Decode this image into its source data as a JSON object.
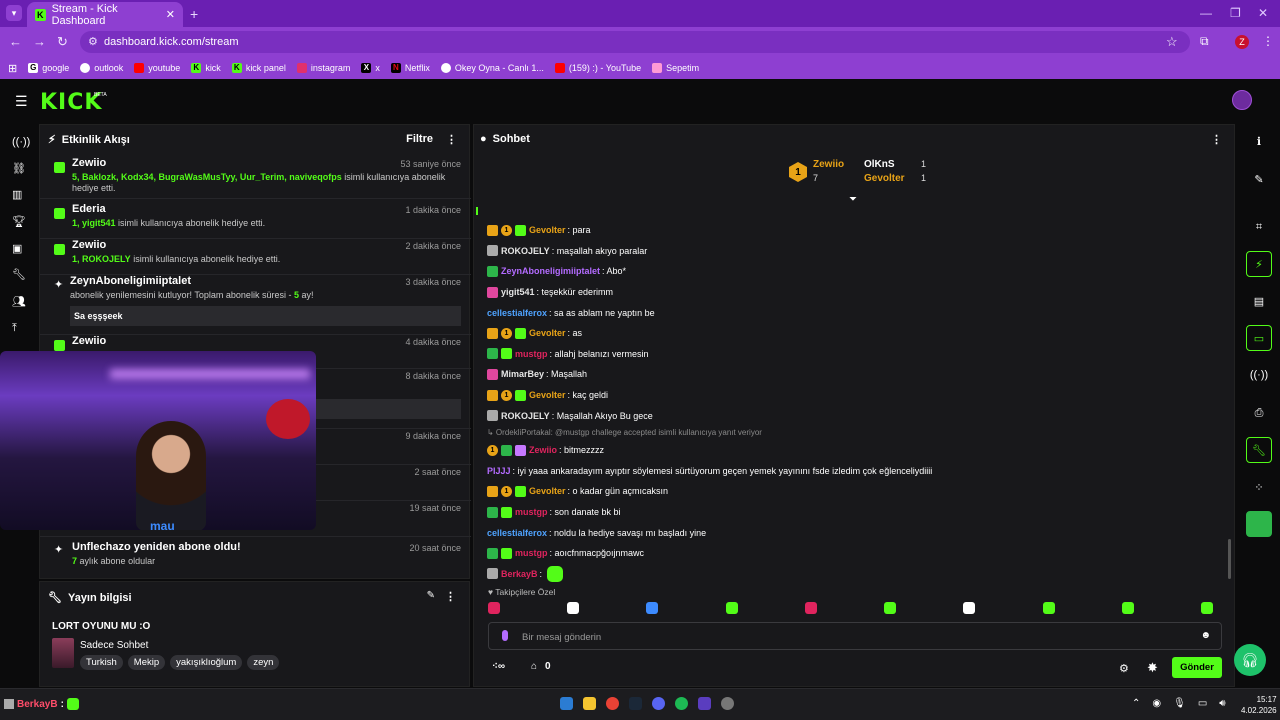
{
  "browser": {
    "tab_title": "Stream - Kick Dashboard",
    "url": "dashboard.kick.com/stream",
    "profile_initial": "Z",
    "bookmarks": [
      "google",
      "outlook",
      "youtube",
      "kick",
      "kick panel",
      "instagram",
      "x",
      "Netflix",
      "Okey Oyna - Canlı 1...",
      "(159) :) - YouTube",
      "Sepetim"
    ]
  },
  "app": {
    "logo": "KICK",
    "beta": "BETA"
  },
  "activity": {
    "title": "Etkinlik Akışı",
    "filter": "Filtre",
    "events": [
      {
        "who": "Zewiio",
        "time": "53 saniye önce",
        "names": "5, Baklozk, Kodx34, BugraWasMusTyy, Uur_Terim, naviveqofps",
        "text": "isimli kullanıcıya abonelik hediye etti."
      },
      {
        "who": "Ederia",
        "time": "1 dakika önce",
        "names": "1, yigit541",
        "text": "isimli kullanıcıya abonelik hediye etti."
      },
      {
        "who": "Zewiio",
        "time": "2 dakika önce",
        "names": "1, ROKOJELY",
        "text": "isimli kullanıcıya abonelik hediye etti."
      },
      {
        "who": "ZeynAboneligimiiptalet",
        "time": "3 dakika önce",
        "text": "abonelik yenilemesini kutluyor! Toplam abonelik süresi -",
        "months": "5",
        "text2": "ay!",
        "message": "Sa eşşşeek"
      },
      {
        "who": "Zewiio",
        "time": "4 dakika önce"
      },
      {
        "time": "8 dakika önce"
      },
      {
        "time": "9 dakika önce"
      },
      {
        "time": "2 saat önce"
      },
      {
        "time": "19 saat önce"
      },
      {
        "who": "Unflechazo yeniden abone oldu!",
        "time": "20 saat önce",
        "names": "7",
        "text": "aylık abone oldular"
      }
    ]
  },
  "webcam": {
    "text": "mau"
  },
  "stream_info": {
    "title": "Yayın bilgisi",
    "stream_title": "LORT OYUNU MU :O",
    "category": "Sadece Sohbet",
    "tags": [
      "Turkish",
      "Mekip",
      "yakışıklıoğlum",
      "zeyn"
    ]
  },
  "chat": {
    "title": "Sohbet",
    "top_gifter": {
      "rank": "1",
      "name": "Zewiio",
      "count": "7"
    },
    "gifters": [
      {
        "name": "OlKnS",
        "count": "1"
      },
      {
        "name": "Gevolter",
        "count": "1"
      }
    ],
    "messages": [
      {
        "badges": [
          "crown",
          "one",
          "gft"
        ],
        "user": "Gevolter",
        "color": "#e8a317",
        "text": ": para"
      },
      {
        "badges": [
          "cat"
        ],
        "user": "ROKOJELY",
        "color": "#e6e6e6",
        "text": ": maşallah akıyo paralar"
      },
      {
        "badges": [
          "fr"
        ],
        "user": "ZeynAboneligimiiptalet",
        "color": "#b36bff",
        "text": ": Abo*"
      },
      {
        "badges": [
          "hrt"
        ],
        "user": "yigit541",
        "color": "#e6e6e6",
        "text": ": teşekkür ederimm"
      },
      {
        "badges": [],
        "user": "cellestialferox",
        "color": "#4fa3ff",
        "text": ": sa as ablam ne yaptın be"
      },
      {
        "badges": [
          "crown",
          "one",
          "gft"
        ],
        "user": "Gevolter",
        "color": "#e8a317",
        "text": ": as"
      },
      {
        "badges": [
          "fr",
          "gft"
        ],
        "user": "mustgp",
        "color": "#e0245e",
        "text": ": allahj belanızı vermesin"
      },
      {
        "badges": [
          "hrt"
        ],
        "user": "MimarBey",
        "color": "#e6e6e6",
        "text": ": Maşallah"
      },
      {
        "badges": [
          "crown",
          "one",
          "gft"
        ],
        "user": "Gevolter",
        "color": "#e8a317",
        "text": ": kaç geldi"
      },
      {
        "badges": [
          "cat"
        ],
        "user": "ROKOJELY",
        "color": "#e6e6e6",
        "text": ": Maşallah Akıyo Bu gece"
      },
      {
        "reply": "↳ OrdekliPortakal: @mustgp challege accepted isimli kullanıcıya yanıt veriyor",
        "badges": [
          "one",
          "fr",
          "gfp"
        ],
        "user": "Zewiio",
        "color": "#e0245e",
        "text": ": bitmezzzz"
      },
      {
        "badges": [],
        "user": "PIJJJ",
        "color": "#b36bff",
        "text": ": iyi yaaa ankaradayım ayıptır söylemesi sürtüyorum geçen yemek yayınını fsde izledim çok eğlenceliydiiii"
      },
      {
        "badges": [
          "crown",
          "one",
          "gft"
        ],
        "user": "Gevolter",
        "color": "#e8a317",
        "text": ": o kadar gün açmıcaksın"
      },
      {
        "badges": [
          "fr",
          "gft"
        ],
        "user": "mustgp",
        "color": "#e0245e",
        "text": ": son danate bk bi"
      },
      {
        "badges": [],
        "user": "cellestialferox",
        "color": "#4fa3ff",
        "text": ": noldu la hediye savaşı mı başladı yine"
      },
      {
        "badges": [
          "fr",
          "gft"
        ],
        "user": "mustgp",
        "color": "#e0245e",
        "text": ": aoıcfnmacpğoıjnmawc"
      },
      {
        "badges": [
          "cat"
        ],
        "user": "BerkayB",
        "color": "#e0245e",
        "text": ":",
        "emote": true
      }
    ],
    "followers_only": "♥ Takipçilere Özel",
    "input_placeholder": "Bir mesaj gönderin",
    "points": "0",
    "send": "Gönder"
  },
  "taskbar": {
    "user": "BerkayB",
    "time": "15:17",
    "date": "4.02.2026"
  }
}
